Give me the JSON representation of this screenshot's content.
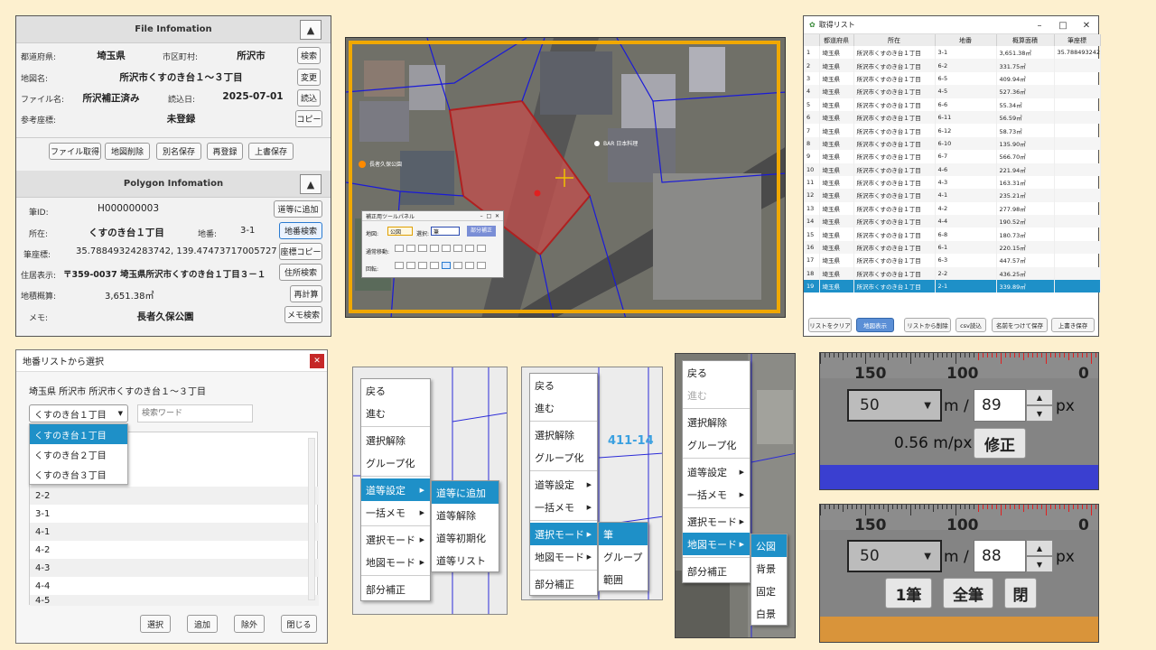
{
  "file_info": {
    "header": "File Infomation",
    "pref_label": "都道府県:",
    "pref_value": "埼玉県",
    "city_label": "市区町村:",
    "city_value": "所沢市",
    "map_label": "地図名:",
    "map_value": "所沢市くすのき台１～３丁目",
    "file_label": "ファイル名:",
    "file_value": "所沢補正済み",
    "date_label": "読込日:",
    "date_value": "2025-07-01",
    "ref_label": "参考座標:",
    "ref_value": "未登録",
    "btn_search": "検索",
    "btn_change": "変更",
    "btn_load": "読込",
    "btn_copy": "コピー",
    "actions": [
      "ファイル取得",
      "地図削除",
      "別名保存",
      "再登録",
      "上書保存"
    ]
  },
  "polygon_info": {
    "header": "Polygon Infomation",
    "id_label": "筆ID:",
    "id_value": "H000000003",
    "loc_label": "所在:",
    "loc_value": "くすのき台１丁目",
    "lot_label": "地番:",
    "lot_value": "3-1",
    "coord_label": "筆座標:",
    "coord_value": "35.78849324283742, 139.47473717005727",
    "addr_label": "住居表示:",
    "addr_value": "〒359-0037 埼玉県所沢市くすのき台１丁目３－１",
    "area_label": "地積概算:",
    "area_value": "3,651.38㎡",
    "memo_label": "メモ:",
    "memo_value": "長者久保公園",
    "btn_road": "道等に追加",
    "btn_lot_search": "地番検索",
    "btn_coord_copy": "座標コピー",
    "btn_addr_search": "住所検索",
    "btn_recalc": "再計算",
    "btn_memo_search": "メモ検索"
  },
  "map_panel": {
    "title": "補正用ツールパネル",
    "map_label": "地図:",
    "map_sel": "公図",
    "mode_label": "選択:",
    "mode_sel": "筆",
    "btn": "部分補正",
    "row1_label": "通常移動:",
    "row2_label": "回転:",
    "place1": "長者久保公園",
    "place2": "BAR 日本料理"
  },
  "list_window": {
    "title": "取得リスト",
    "columns": [
      "",
      "都道府県",
      "所在",
      "地番",
      "概算面積",
      "筆座標"
    ],
    "rows": [
      [
        "1",
        "埼玉県",
        "所沢市くすのき台１丁目",
        "3-1",
        "3,651.38㎡",
        "35.78849324283..."
      ],
      [
        "2",
        "埼玉県",
        "所沢市くすのき台１丁目",
        "6-2",
        "331.75㎡",
        ""
      ],
      [
        "3",
        "埼玉県",
        "所沢市くすのき台１丁目",
        "6-5",
        "409.94㎡",
        ""
      ],
      [
        "4",
        "埼玉県",
        "所沢市くすのき台１丁目",
        "4-5",
        "527.36㎡",
        ""
      ],
      [
        "5",
        "埼玉県",
        "所沢市くすのき台１丁目",
        "6-6",
        "55.34㎡",
        ""
      ],
      [
        "6",
        "埼玉県",
        "所沢市くすのき台１丁目",
        "6-11",
        "56.59㎡",
        ""
      ],
      [
        "7",
        "埼玉県",
        "所沢市くすのき台１丁目",
        "6-12",
        "58.73㎡",
        ""
      ],
      [
        "8",
        "埼玉県",
        "所沢市くすのき台１丁目",
        "6-10",
        "135.90㎡",
        ""
      ],
      [
        "9",
        "埼玉県",
        "所沢市くすのき台１丁目",
        "6-7",
        "566.70㎡",
        ""
      ],
      [
        "10",
        "埼玉県",
        "所沢市くすのき台１丁目",
        "4-6",
        "221.94㎡",
        ""
      ],
      [
        "11",
        "埼玉県",
        "所沢市くすのき台１丁目",
        "4-3",
        "163.31㎡",
        ""
      ],
      [
        "12",
        "埼玉県",
        "所沢市くすのき台１丁目",
        "4-1",
        "235.21㎡",
        ""
      ],
      [
        "13",
        "埼玉県",
        "所沢市くすのき台１丁目",
        "4-2",
        "277.98㎡",
        ""
      ],
      [
        "14",
        "埼玉県",
        "所沢市くすのき台１丁目",
        "4-4",
        "190.52㎡",
        ""
      ],
      [
        "15",
        "埼玉県",
        "所沢市くすのき台１丁目",
        "6-8",
        "180.73㎡",
        ""
      ],
      [
        "16",
        "埼玉県",
        "所沢市くすのき台１丁目",
        "6-1",
        "220.15㎡",
        ""
      ],
      [
        "17",
        "埼玉県",
        "所沢市くすのき台１丁目",
        "6-3",
        "447.57㎡",
        ""
      ],
      [
        "18",
        "埼玉県",
        "所沢市くすのき台１丁目",
        "2-2",
        "436.25㎡",
        ""
      ],
      [
        "19",
        "埼玉県",
        "所沢市くすのき台１丁目",
        "2-1",
        "339.89㎡",
        ""
      ]
    ],
    "buttons": [
      "リストをクリア",
      "地図表示",
      "リストから削除",
      "csv読込",
      "名前をつけて保存",
      "上書き保存"
    ]
  },
  "lot_select": {
    "title": "地番リストから選択",
    "path": "埼玉県 所沢市 所沢市くすのき台１～３丁目",
    "combo": "くすのき台１丁目",
    "search_placeholder": "検索ワード",
    "options": [
      "くすのき台１丁目",
      "くすのき台２丁目",
      "くすのき台３丁目"
    ],
    "items": [
      "2-2",
      "3-1",
      "4-1",
      "4-2",
      "4-3",
      "4-4",
      "4-5"
    ],
    "buttons": [
      "選択",
      "追加",
      "除外",
      "閉じる"
    ]
  },
  "menu1": {
    "items": [
      "戻る",
      "進む",
      "選択解除",
      "グループ化",
      "道等設定",
      "一括メモ",
      "選択モード",
      "地図モード",
      "部分補正"
    ],
    "sub": [
      "道等に追加",
      "道等解除",
      "道等初期化",
      "道等リスト"
    ]
  },
  "menu2": {
    "items": [
      "戻る",
      "進む",
      "選択解除",
      "グループ化",
      "道等設定",
      "一括メモ",
      "選択モード",
      "地図モード",
      "部分補正"
    ],
    "sub": [
      "筆",
      "グループ",
      "範囲"
    ],
    "bg_label_1": "411-14",
    "bg_label_2": "411"
  },
  "menu3": {
    "items": [
      "戻る",
      "進む",
      "選択解除",
      "グループ化",
      "道等設定",
      "一括メモ",
      "選択モード",
      "地図モード",
      "部分補正"
    ],
    "sub": [
      "公図",
      "背景",
      "固定",
      "白景"
    ]
  },
  "scale1": {
    "ticks": [
      "150",
      "100",
      "0"
    ],
    "combo": "50",
    "unit1": "m /",
    "spin": "89",
    "unit2": "px",
    "ratio": "0.56 m/px",
    "btn": "修正",
    "bar_color": "#3a3fd0"
  },
  "scale2": {
    "ticks": [
      "150",
      "100",
      "0"
    ],
    "combo": "50",
    "unit1": "m /",
    "spin": "88",
    "unit2": "px",
    "buttons": [
      "1筆",
      "全筆",
      "閉"
    ],
    "bar_color": "#d9943a"
  }
}
